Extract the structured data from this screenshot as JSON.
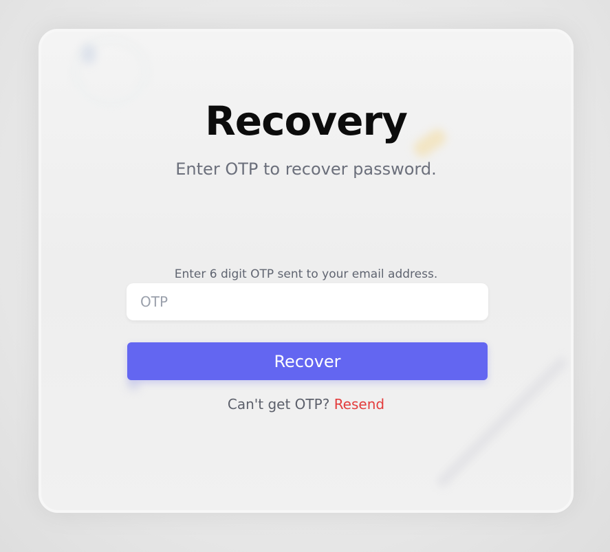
{
  "recovery": {
    "title": "Recovery",
    "subtitle": "Enter OTP to recover password.",
    "otp_hint": "Enter 6 digit OTP sent to your email address.",
    "otp_placeholder": "OTP",
    "otp_value": "",
    "recover_button": "Recover",
    "resend_prompt": "Can't get OTP?",
    "resend_link": "Resend"
  },
  "colors": {
    "accent": "#6366f1",
    "resend": "#e33c3c",
    "title": "#0c0c0c",
    "muted_text": "#6b6f7b"
  }
}
